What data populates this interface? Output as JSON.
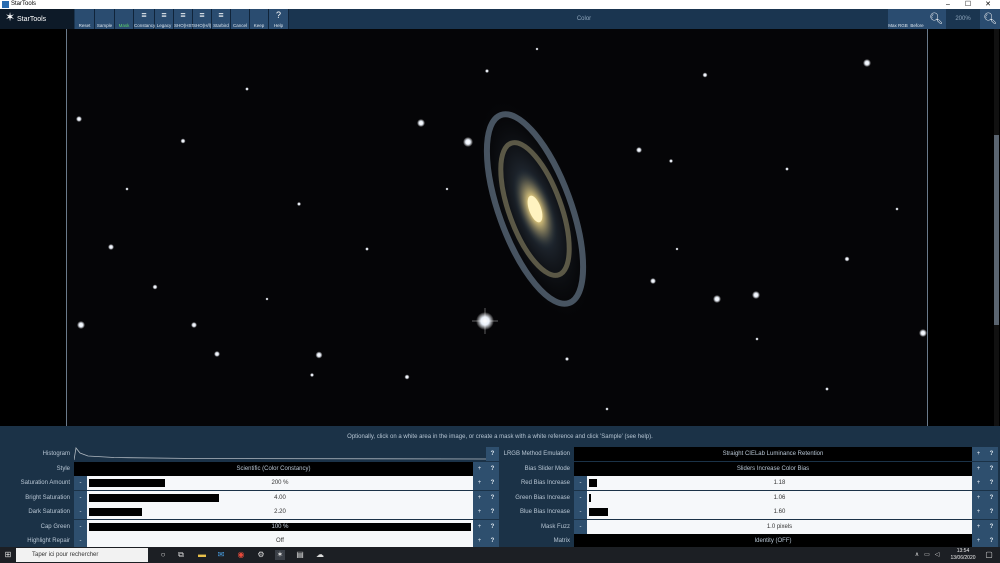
{
  "window": {
    "title": "StarTools",
    "controls": [
      "–",
      "☐",
      "✕"
    ]
  },
  "toolbar": {
    "logo_text": "StarTools",
    "buttons": [
      {
        "label": "Reset",
        "icon": ""
      },
      {
        "label": "Sample",
        "icon": ""
      },
      {
        "label": "Mask",
        "icon": ""
      },
      {
        "label": "Constancy",
        "icon": "≡"
      },
      {
        "label": "Legacy",
        "icon": "≡"
      },
      {
        "label": "SHO(HST)",
        "icon": "≡"
      },
      {
        "label": "SHO(H/l)",
        "icon": "≡"
      },
      {
        "label": "Starbird",
        "icon": "≡"
      },
      {
        "label": "Cancel",
        "icon": ""
      },
      {
        "label": "Keep",
        "icon": ""
      },
      {
        "label": "Help",
        "icon": "?"
      }
    ],
    "module_title": "Color",
    "right_buttons": [
      "Max RGB",
      "Before"
    ],
    "zoom_level": "200%"
  },
  "panel": {
    "hint": "Optionally, click on a white area in the image, or create a mask with a white reference and click 'Sample' (see help).",
    "histogram_label": "Histogram",
    "left": [
      {
        "label": "Style",
        "type": "drop",
        "value": "Scientific (Color Constancy)"
      },
      {
        "label": "Saturation Amount",
        "type": "slider",
        "value": "200 %",
        "fill": 0.2
      },
      {
        "label": "Bright Saturation",
        "type": "slider",
        "value": "4.00",
        "fill": 0.34
      },
      {
        "label": "Dark Saturation",
        "type": "slider",
        "value": "2.20",
        "fill": 0.14
      },
      {
        "label": "Cap Green",
        "type": "slider",
        "value": "100 %",
        "fill": 1.0
      },
      {
        "label": "Highlight Repair",
        "type": "slider",
        "value": "Off",
        "fill": 0
      }
    ],
    "right": [
      {
        "label": "LRGB Method Emulation",
        "type": "drop",
        "value": "Straight CIELab Luminance Retention"
      },
      {
        "label": "Bias Slider Mode",
        "type": "drop",
        "value": "Sliders Increase Color Bias"
      },
      {
        "label": "Red Bias Increase",
        "type": "slider",
        "value": "1.18",
        "fill": 0.02
      },
      {
        "label": "Green Bias Increase",
        "type": "slider",
        "value": "1.06",
        "fill": 0.005
      },
      {
        "label": "Blue Bias Increase",
        "type": "slider",
        "value": "1.60",
        "fill": 0.05
      },
      {
        "label": "Mask Fuzz",
        "type": "slider",
        "value": "1.0 pixels",
        "fill": 0
      },
      {
        "label": "Matrix",
        "type": "drop",
        "value": "Identity (OFF)"
      }
    ],
    "minus": "-",
    "plus": "+",
    "help": "?"
  },
  "taskbar": {
    "search_placeholder": "Taper ici pour rechercher",
    "time": "13:54",
    "date": "13/06/2020"
  }
}
